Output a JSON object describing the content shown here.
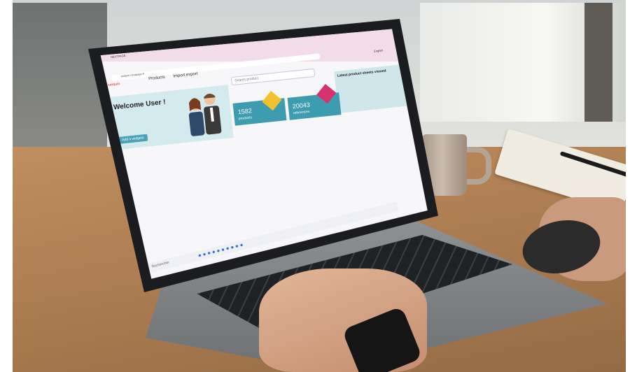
{
  "browser": {
    "tab_title": "NEXTPAGE",
    "url": "saiquin.nextpage.fr",
    "language": "English"
  },
  "app": {
    "logo": "saiquin",
    "nav": [
      "Products",
      "Import export"
    ],
    "search_placeholder": "Search product",
    "latest_title": "Latest product sheets viewed"
  },
  "welcome": {
    "title": "Welcome User !",
    "add_button": "Add a widgets"
  },
  "stats": [
    {
      "value": "1582",
      "label": "products",
      "color": "#f2c12e"
    },
    {
      "value": "20043",
      "label": "references",
      "color": "#d6336c"
    }
  ],
  "taskbar": {
    "search_label": "Rechercher"
  },
  "colors": {
    "tab_bar": "#f3dcea",
    "accent": "#3d9cb0",
    "panel": "#d3eaee",
    "logo": "#e65a5a"
  }
}
